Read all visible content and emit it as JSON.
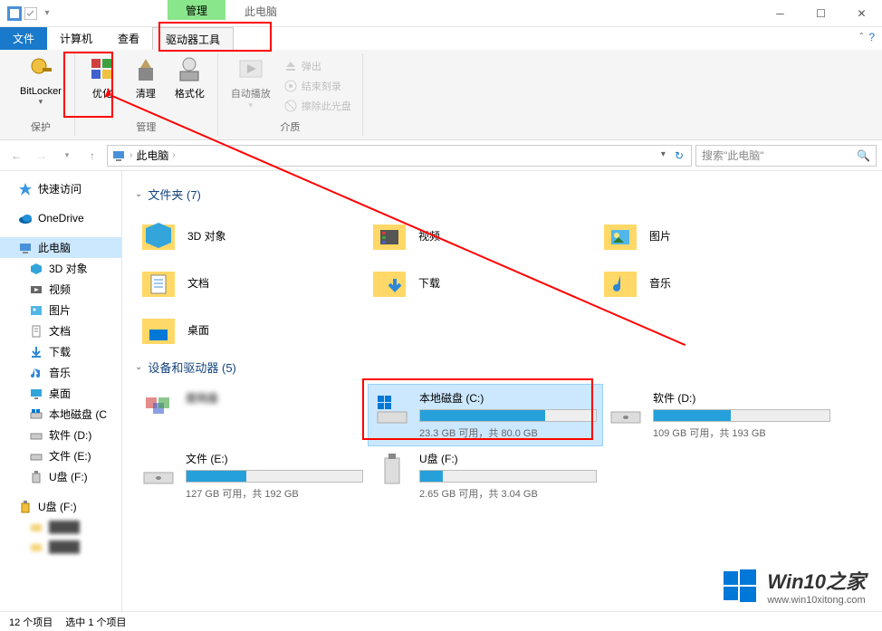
{
  "title": {
    "context_tab": "管理",
    "window_title": "此电脑"
  },
  "tabs": {
    "file": "文件",
    "computer": "计算机",
    "view": "查看",
    "drive_tools": "驱动器工具"
  },
  "ribbon": {
    "bitlocker": "BitLocker",
    "optimize": "优化",
    "cleanup": "清理",
    "format": "格式化",
    "autoplay": "自动播放",
    "eject": "弹出",
    "finish_burn": "结束刻录",
    "erase_disc": "擦除此光盘",
    "group_protect": "保护",
    "group_manage": "管理",
    "group_media": "介质"
  },
  "address": {
    "this_pc": "此电脑"
  },
  "search": {
    "placeholder": "搜索\"此电脑\""
  },
  "sidebar": {
    "quick_access": "快速访问",
    "onedrive": "OneDrive",
    "this_pc": "此电脑",
    "objects_3d": "3D 对象",
    "videos": "视频",
    "pictures": "图片",
    "documents": "文档",
    "downloads": "下载",
    "music": "音乐",
    "desktop": "桌面",
    "local_disk_c": "本地磁盘 (C",
    "software_d": "软件 (D:)",
    "files_e": "文件 (E:)",
    "udisk_f": "U盘 (F:)",
    "udisk_f2": "U盘 (F:)"
  },
  "sections": {
    "folders": "文件夹 (7)",
    "devices": "设备和驱动器 (5)"
  },
  "folders": {
    "objects_3d": "3D 对象",
    "videos": "视频",
    "pictures": "图片",
    "documents": "文档",
    "downloads": "下载",
    "music": "音乐",
    "desktop": "桌面"
  },
  "drives": [
    {
      "name_blur": "度网盘",
      "stats": ""
    },
    {
      "name": "本地磁盘 (C:)",
      "stats": "23.3 GB 可用，共 80.0 GB",
      "fill": 71
    },
    {
      "name": "软件 (D:)",
      "stats": "109 GB 可用，共 193 GB",
      "fill": 44
    },
    {
      "name": "文件 (E:)",
      "stats": "127 GB 可用，共 192 GB",
      "fill": 34
    },
    {
      "name": "U盘 (F:)",
      "stats": "2.65 GB 可用，共 3.04 GB",
      "fill": 13
    }
  ],
  "statusbar": {
    "items": "12 个项目",
    "selected": "选中 1 个项目"
  },
  "watermark": {
    "title": "Win10之家",
    "sub": "www.win10xitong.com"
  }
}
